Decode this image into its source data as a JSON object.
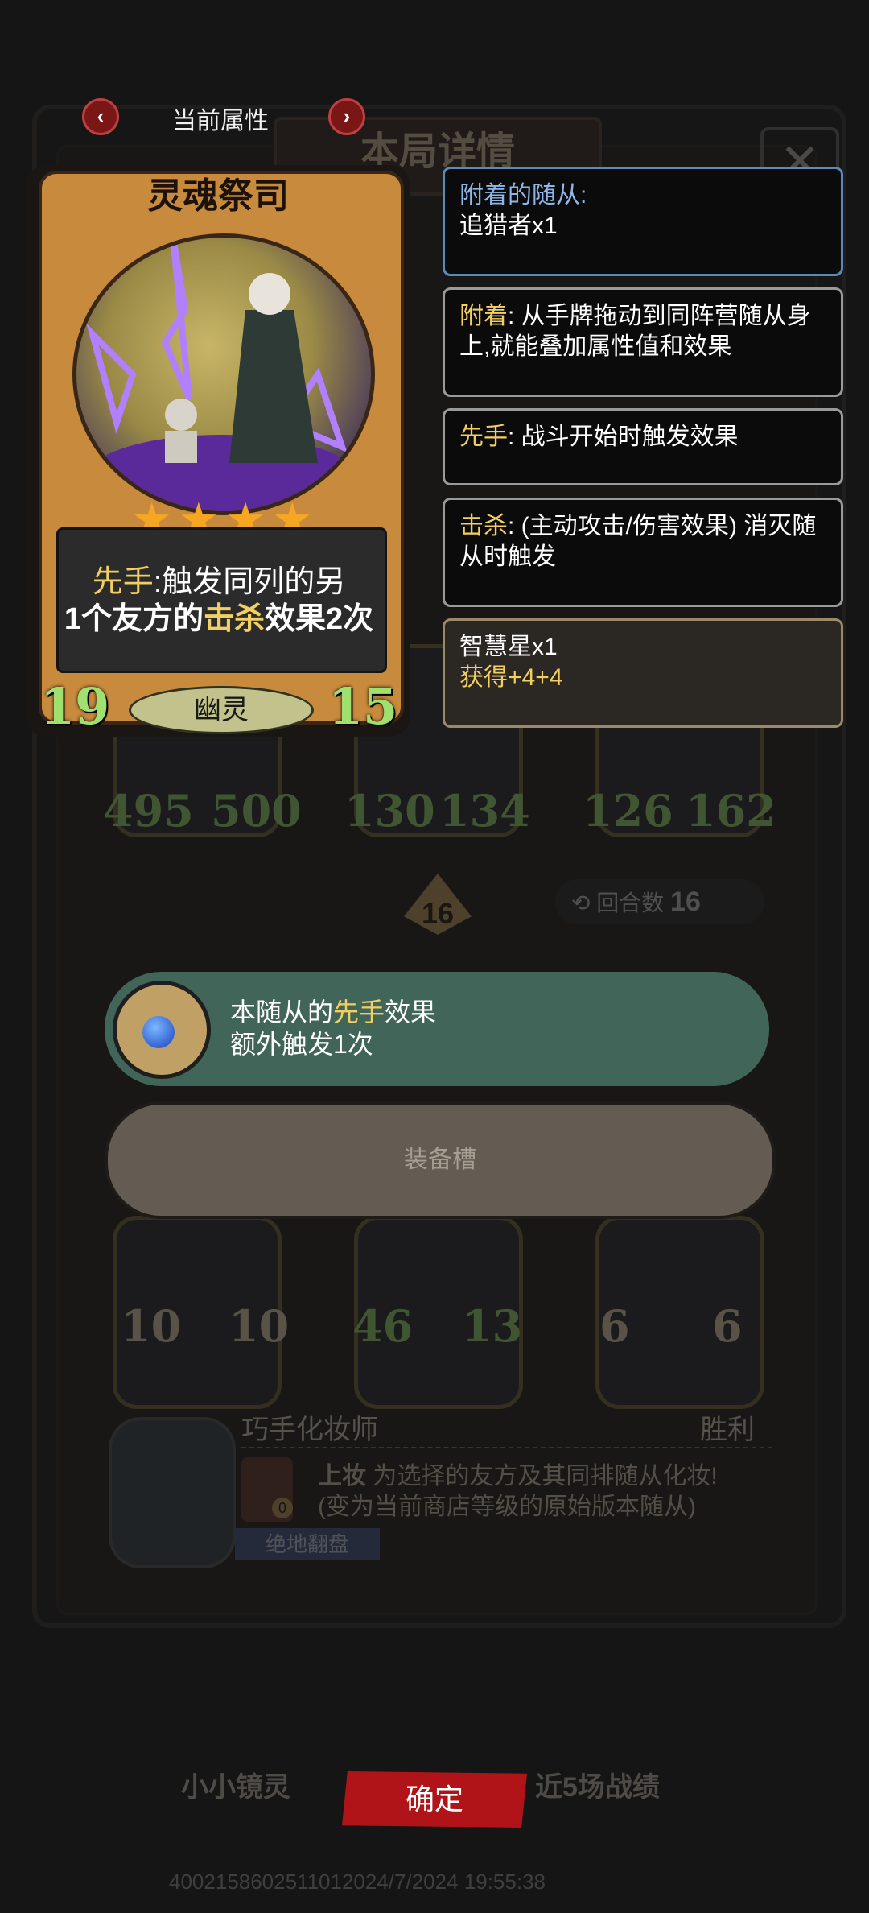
{
  "header": {
    "prev_icon": "chevron-left-icon",
    "next_icon": "chevron-right-icon",
    "title": "当前属性"
  },
  "background": {
    "panel_title": "本局详情",
    "close_icon": "close-x-icon",
    "row1": [
      {
        "atk": "495",
        "hp": "500"
      },
      {
        "atk": "130",
        "hp": "134"
      },
      {
        "atk": "126",
        "hp": "162"
      }
    ],
    "round_badge": "16",
    "round_label": "回合数",
    "round_value": "16",
    "row2": [
      {
        "atk": "10",
        "hp": "10"
      },
      {
        "atk": "46",
        "hp": "13"
      },
      {
        "atk": "6",
        "hp": "6"
      }
    ],
    "hero": {
      "name": "巧手化妆师",
      "result": "胜利",
      "skill_name": "上妆",
      "skill_line1": "为选择的友方及其同排随从化妆!",
      "skill_line2": "(变为当前商店等级的原始版本随从)",
      "cost": "0",
      "tag": "绝地翻盘"
    },
    "footer_left": "小小镜灵",
    "footer_right": "近5场战绩",
    "footer_id": "4002158602511012024/7/2024 19:55:38"
  },
  "card": {
    "name": "灵魂祭司",
    "stars": "★★★★",
    "desc_part1": "先手",
    "desc_part2": ":触发同列的另",
    "desc_part3": "1个友方的",
    "desc_part4": "击杀",
    "desc_part5": "效果2次",
    "tribe": "幽灵",
    "attack": "19",
    "health": "15"
  },
  "info_panels": {
    "attached_label": "附着的随从:",
    "attached_value": "追猎者x1",
    "attach_term": "附着",
    "attach_desc": ": 从手牌拖动到同阵营随从身上,就能叠加属性值和效果",
    "first_term": "先手",
    "first_desc": ": 战斗开始时触发效果",
    "kill_term": "击杀",
    "kill_desc": ": (主动攻击/伤害效果) 消灭随从时触发",
    "wisdom_title": "智慧星x1",
    "wisdom_gain": "获得+4+4"
  },
  "bonus": {
    "line1_a": "本随从的",
    "line1_b": "先手",
    "line1_c": "效果",
    "line2": "额外触发1次",
    "slot_label": "装备槽"
  },
  "confirm_label": "确定",
  "colors": {
    "highlight": "#f3cf63",
    "stat_green": "#9fe070",
    "confirm_red": "#b01418",
    "banner_green": "#416659"
  }
}
